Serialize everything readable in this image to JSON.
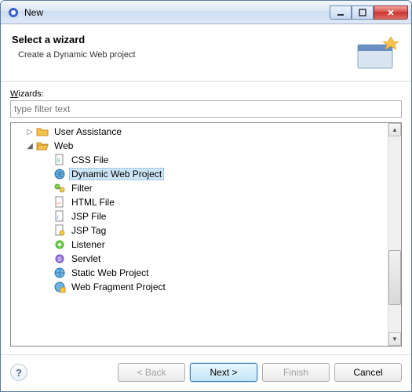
{
  "window": {
    "title": "New"
  },
  "header": {
    "title": "Select a wizard",
    "desc": "Create a Dynamic Web project"
  },
  "wizards_label": "Wizards:",
  "filter_placeholder": "type filter text",
  "tree": {
    "user_assistance": "User Assistance",
    "web": "Web",
    "items": [
      "CSS File",
      "Dynamic Web Project",
      "Filter",
      "HTML File",
      "JSP File",
      "JSP Tag",
      "Listener",
      "Servlet",
      "Static Web Project",
      "Web Fragment Project"
    ]
  },
  "buttons": {
    "back": "< Back",
    "next": "Next >",
    "finish": "Finish",
    "cancel": "Cancel"
  }
}
